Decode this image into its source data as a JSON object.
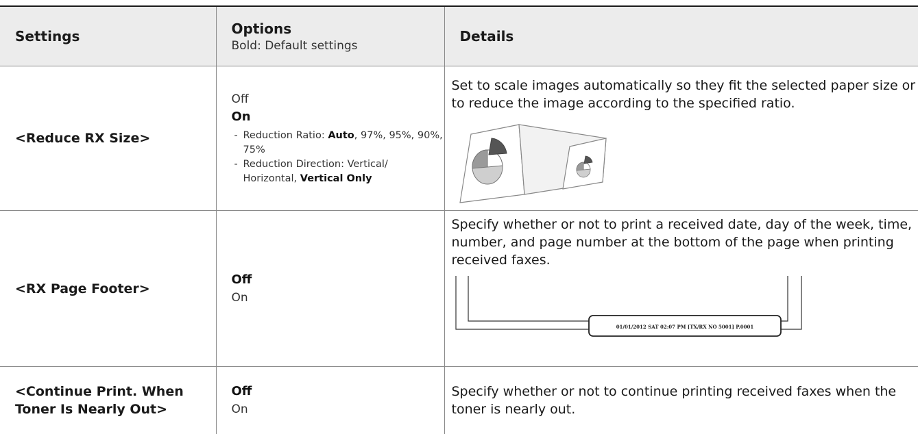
{
  "header": {
    "settings": "Settings",
    "options": "Options",
    "options_note": "Bold: Default settings",
    "details": "Details"
  },
  "rows": [
    {
      "setting": "<Reduce RX Size>",
      "options": [
        "Off",
        "On"
      ],
      "default_option": "On",
      "sub_options": [
        {
          "prefix": "Reduction Ratio: ",
          "bold": "Auto",
          "rest": ", 97%, 95%, 90%, 75%"
        },
        {
          "prefix": "Reduction Direction: Vertical/ Horizontal, ",
          "bold": "Vertical Only",
          "rest": ""
        }
      ],
      "details": "Set to scale images automatically so they fit the selected paper size or to reduce the image according to the specified ratio."
    },
    {
      "setting": "<RX Page Footer>",
      "options": [
        "Off",
        "On"
      ],
      "default_option": "Off",
      "details": "Specify whether or not to print a received date, day of the week, time, number, and page number at the bottom of the page when printing received faxes.",
      "footer_sample": "01/01/2012 SAT 02:07 PM [TX/RX NO 5001] P.0001"
    },
    {
      "setting": "<Continue Print. When Toner Is Nearly Out>",
      "options": [
        "Off",
        "On"
      ],
      "default_option": "Off",
      "details": "Specify whether or not to continue printing received faxes when the toner is nearly out."
    }
  ]
}
